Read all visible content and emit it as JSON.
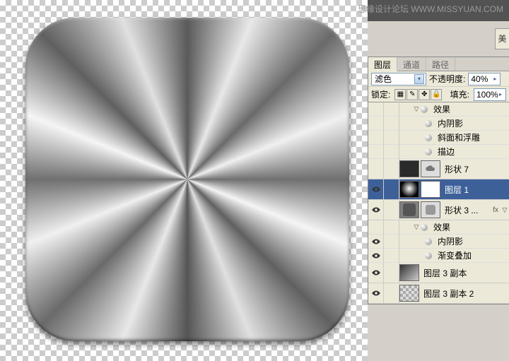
{
  "watermark": "思缘设计论坛  WWW.MISSYUAN.COM",
  "btn_stub": "美",
  "tabs": {
    "layers": "图层",
    "channels": "通道",
    "paths": "路径"
  },
  "blend": {
    "mode": "滤色",
    "opacity_label": "不透明度:",
    "opacity_value": "40%"
  },
  "lock": {
    "label": "锁定:",
    "fill_label": "填充:",
    "fill_value": "100%"
  },
  "fx": {
    "effects": "效果",
    "inner_shadow": "内阴影",
    "bevel": "斜面和浮雕",
    "stroke": "描边",
    "grad_overlay": "渐变叠加"
  },
  "layers": {
    "shape7": "形状 7",
    "layer1": "图层 1",
    "shape3": "形状 3 ...",
    "layer3copy": "图层 3 副本",
    "layer3copy2": "图层 3 副本 2"
  },
  "fx_badge": "fx",
  "twist_down": "▽",
  "twist_right": "▷"
}
